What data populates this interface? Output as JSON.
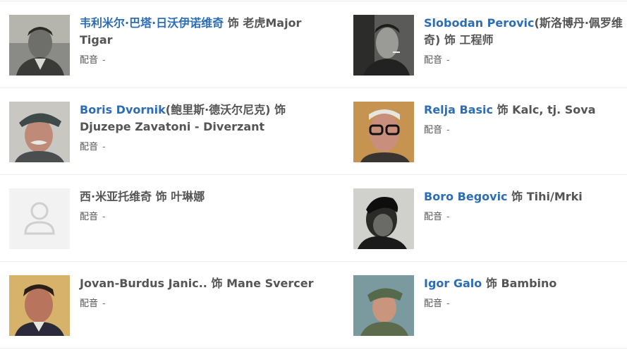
{
  "separator": "饰",
  "dub_label": "配音",
  "dub_value": "-",
  "cast": [
    {
      "actor": "韦利米尔·巴塔·日沃伊诺维奇",
      "role": "老虎Major Tigar",
      "linked": true,
      "photo": "actor-photo-bw"
    },
    {
      "actor": "Slobodan Perovic",
      "actor_extra": "(斯洛博丹·佩罗维奇)",
      "role": "工程师",
      "linked": true,
      "photo": "actor-photo-bw"
    },
    {
      "actor": "Boris Dvornik",
      "actor_extra": "(鲍里斯·德沃尔尼克)",
      "role": "Djuzepe Zavatoni - Diverzant",
      "linked": true,
      "photo": "actor-photo-color"
    },
    {
      "actor": "Relja Basic",
      "role": "Kalc, tj. Sova",
      "linked": true,
      "photo": "actor-photo-color"
    },
    {
      "actor": "西·米亚托维奇",
      "role": "叶琳娜",
      "linked": false,
      "photo": "placeholder-avatar"
    },
    {
      "actor": "Boro Begovic",
      "role": "Tihi/Mrki",
      "linked": true,
      "photo": "actor-photo-bw"
    },
    {
      "actor": "Jovan-Burdus Janic..",
      "role": "Mane Svercer",
      "linked": false,
      "photo": "actor-photo-color"
    },
    {
      "actor": "Igor Galo",
      "role": "Bambino",
      "linked": true,
      "photo": "actor-photo-color"
    }
  ]
}
